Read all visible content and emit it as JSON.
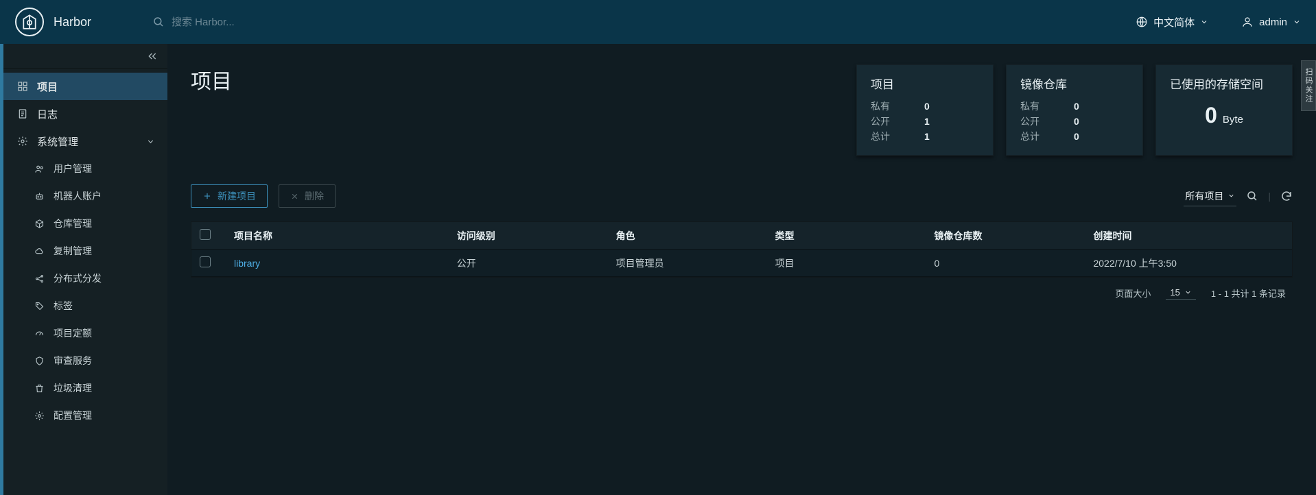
{
  "header": {
    "app_name": "Harbor",
    "search_placeholder": "搜索 Harbor...",
    "language": "中文简体",
    "user": "admin"
  },
  "sidebar": {
    "projects": "项目",
    "logs": "日志",
    "admin": "系统管理",
    "sub": {
      "users": "用户管理",
      "robots": "机器人账户",
      "repos": "仓库管理",
      "replication": "复制管理",
      "distribution": "分布式分发",
      "labels": "标签",
      "quotas": "项目定额",
      "audit": "审查服务",
      "gc": "垃圾清理",
      "config": "配置管理"
    }
  },
  "page": {
    "title": "项目",
    "right_tab": "扫码关注"
  },
  "cards": {
    "projects": {
      "title": "项目",
      "private_lbl": "私有",
      "private_val": "0",
      "public_lbl": "公开",
      "public_val": "1",
      "total_lbl": "总计",
      "total_val": "1"
    },
    "repos": {
      "title": "镜像仓库",
      "private_lbl": "私有",
      "private_val": "0",
      "public_lbl": "公开",
      "public_val": "0",
      "total_lbl": "总计",
      "total_val": "0"
    },
    "storage": {
      "title": "已使用的存储空间",
      "value": "0",
      "unit": "Byte"
    }
  },
  "toolbar": {
    "new_project": "新建项目",
    "delete": "删除",
    "filter": "所有项目"
  },
  "table": {
    "cols": {
      "name": "项目名称",
      "access": "访问级别",
      "role": "角色",
      "type": "类型",
      "repo_count": "镜像仓库数",
      "created": "创建时间"
    },
    "rows": [
      {
        "name": "library",
        "access": "公开",
        "role": "项目管理员",
        "type": "项目",
        "repo_count": "0",
        "created": "2022/7/10 上午3:50"
      }
    ]
  },
  "pager": {
    "page_size_lbl": "页面大小",
    "page_size": "15",
    "summary": "1 - 1 共计 1 条记录"
  }
}
